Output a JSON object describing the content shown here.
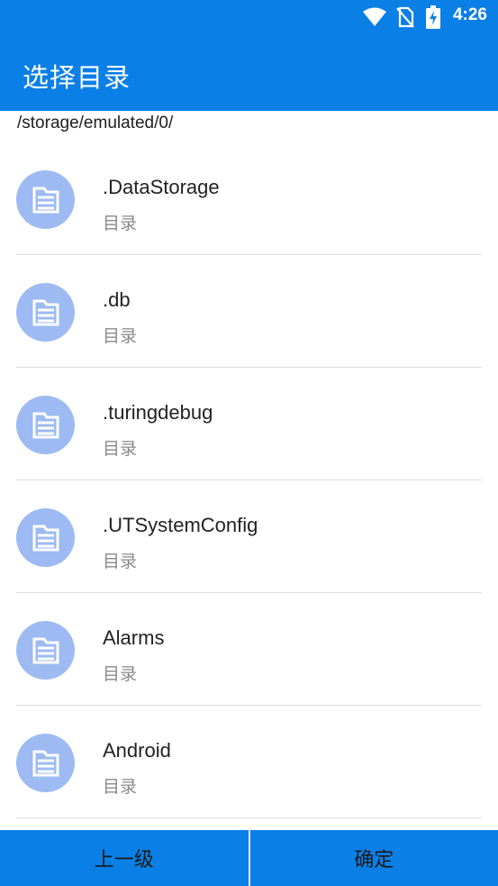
{
  "status_bar": {
    "time": "4:26",
    "icons": [
      "wifi-icon",
      "no-sim-icon",
      "battery-charging-icon"
    ]
  },
  "app_bar": {
    "title": "选择目录"
  },
  "current_path": "/storage/emulated/0/",
  "items": [
    {
      "name": ".DataStorage",
      "type": "目录",
      "icon": "folder-icon"
    },
    {
      "name": ".db",
      "type": "目录",
      "icon": "folder-icon"
    },
    {
      "name": ".turingdebug",
      "type": "目录",
      "icon": "folder-icon"
    },
    {
      "name": ".UTSystemConfig",
      "type": "目录",
      "icon": "folder-icon"
    },
    {
      "name": "Alarms",
      "type": "目录",
      "icon": "folder-icon"
    },
    {
      "name": "Android",
      "type": "目录",
      "icon": "folder-icon"
    }
  ],
  "bottom_bar": {
    "up_label": "上一级",
    "confirm_label": "确定"
  },
  "colors": {
    "primary": "#0a7fe6",
    "folder_icon_bg": "#9dbbf2"
  }
}
